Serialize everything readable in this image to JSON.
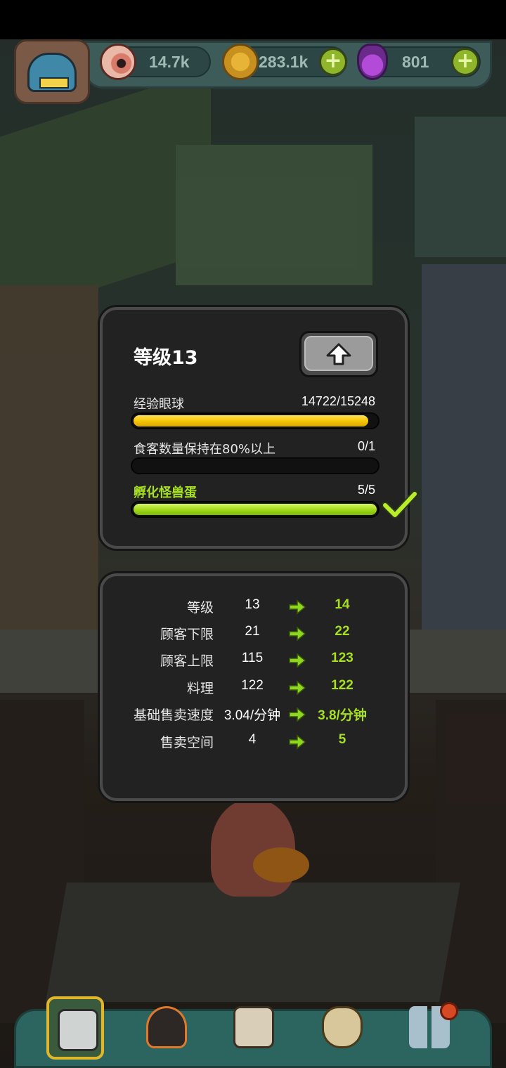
{
  "resources": {
    "eyeballs": "14.7k",
    "coins": "283.1k",
    "potions": "801"
  },
  "level_panel": {
    "title": "等级13",
    "tasks": [
      {
        "label": "经验眼球",
        "progress_text": "14722/15248",
        "progress": 0.9655,
        "bar_color": "#f5c400",
        "completed": false
      },
      {
        "label": "食客数量保持在80%以上",
        "progress_text": "0/1",
        "progress": 0.0,
        "bar_color": "#111111",
        "completed": false
      },
      {
        "label": "孵化怪兽蛋",
        "progress_text": "5/5",
        "progress": 1.0,
        "bar_color": "#9fd816",
        "completed": true
      }
    ]
  },
  "stats_panel": {
    "rows": [
      {
        "label": "等级",
        "current": "13",
        "next": "14"
      },
      {
        "label": "顾客下限",
        "current": "21",
        "next": "22"
      },
      {
        "label": "顾客上限",
        "current": "115",
        "next": "123"
      },
      {
        "label": "料理",
        "current": "122",
        "next": "122"
      },
      {
        "label": "基础售卖速度",
        "current": "3.04/分钟",
        "next": "3.8/分钟"
      },
      {
        "label": "售卖空间",
        "current": "4",
        "next": "5"
      }
    ]
  },
  "nav": {
    "items": [
      "restaurant-icon",
      "monster-icon",
      "book-icon",
      "coin-bag-icon",
      "grid-menu-icon"
    ],
    "selected": 0
  },
  "colors": {
    "accent_green": "#a6e01e",
    "accent_yellow": "#f5c400",
    "panel_bg": "#222222"
  }
}
